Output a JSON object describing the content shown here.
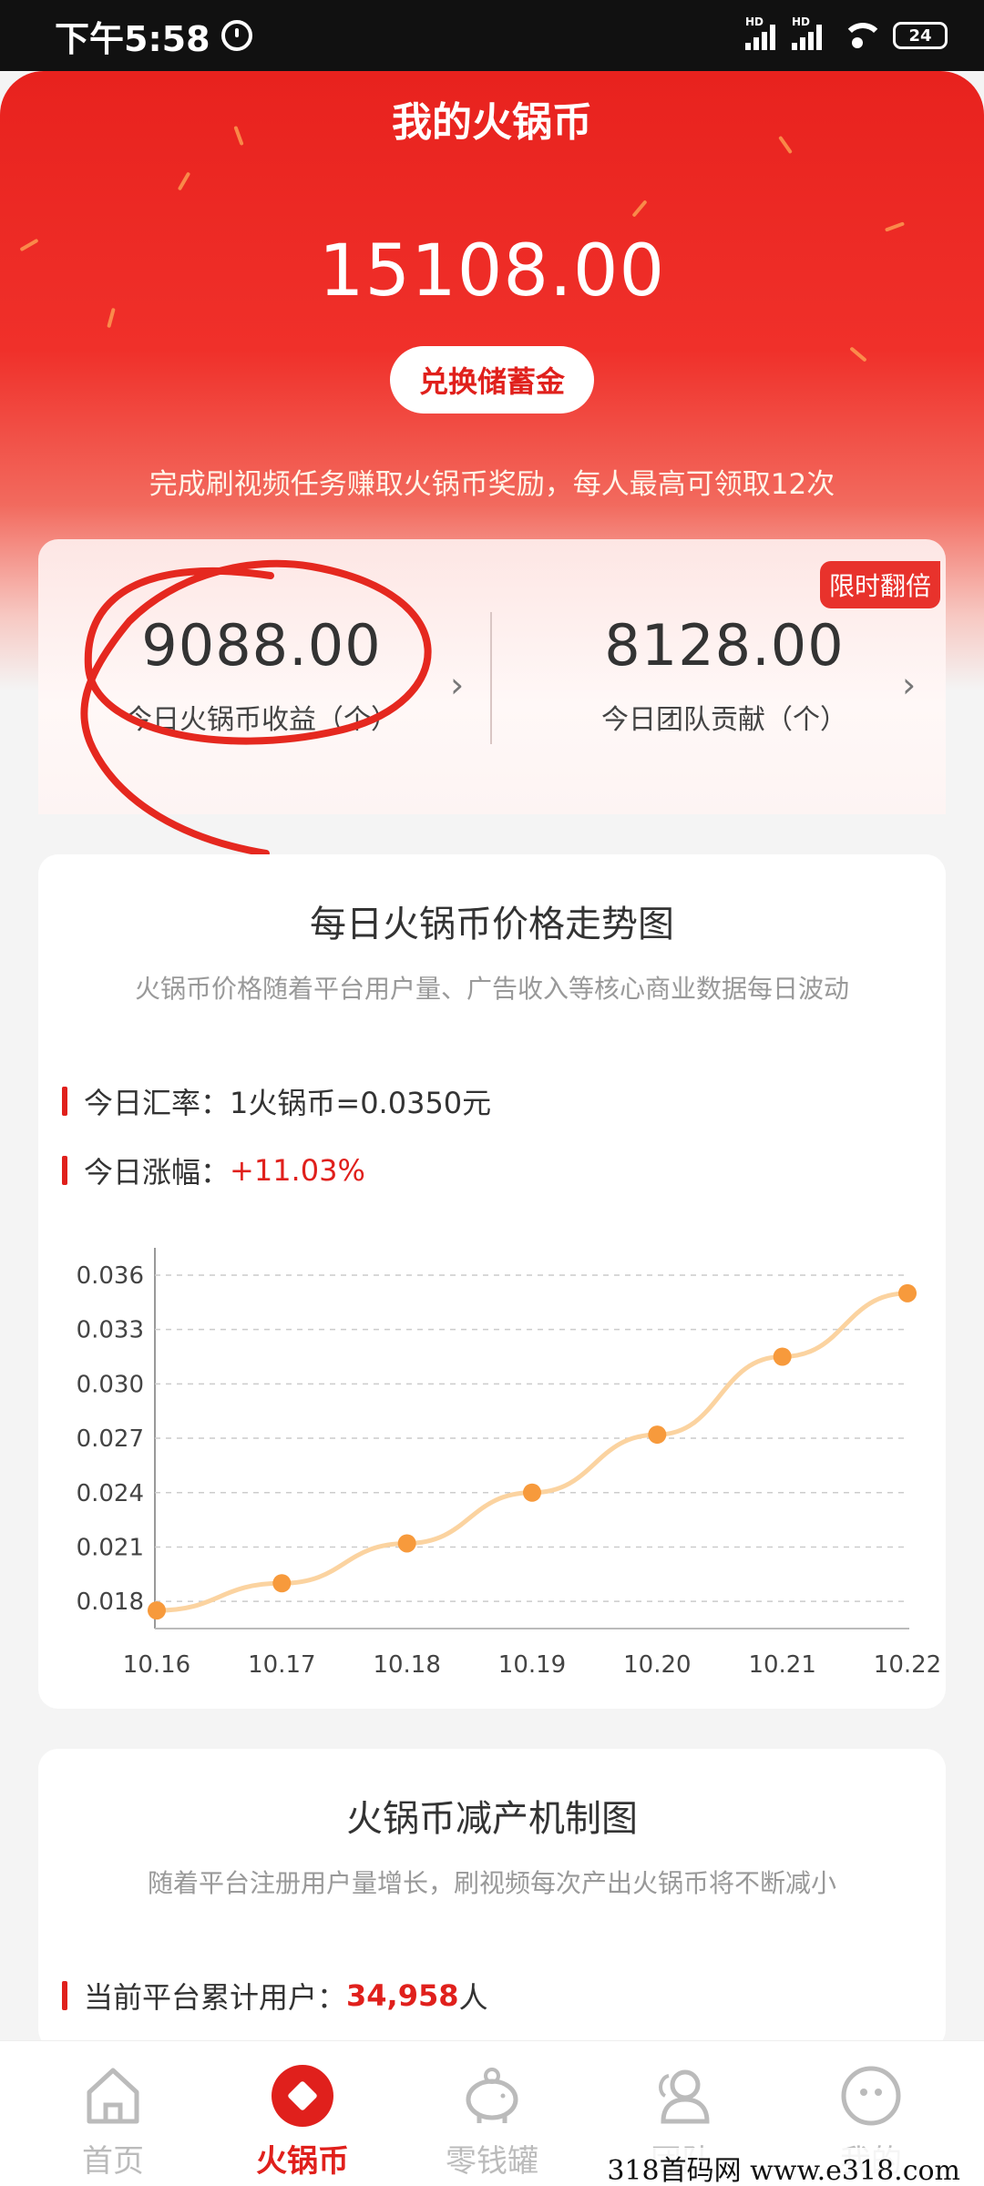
{
  "status_bar": {
    "time": "下午5:58",
    "hd1": "HD",
    "hd2": "HD",
    "battery": "24"
  },
  "header": {
    "title": "我的火锅币",
    "balance": "15108.00",
    "exchange_button": "兑换储蓄金",
    "task_desc": "完成刷视频任务赚取火锅币奖励，每人最高可领取12次"
  },
  "stats": {
    "badge": "限时翻倍",
    "today_earnings_value": "9088.00",
    "today_earnings_label": "今日火锅币收益（个）",
    "team_contribution_value": "8128.00",
    "team_contribution_label": "今日团队贡献（个）"
  },
  "price_card": {
    "title": "每日火锅币价格走势图",
    "subtitle": "火锅币价格随着平台用户量、广告收入等核心商业数据每日波动",
    "rate_label": "今日汇率：",
    "rate_value": "1火锅币=0.0350元",
    "change_label": "今日涨幅：",
    "change_value": "+11.03%"
  },
  "chart_data": {
    "type": "line",
    "title": "",
    "xlabel": "",
    "ylabel": "",
    "categories": [
      "10.16",
      "10.17",
      "10.18",
      "10.19",
      "10.20",
      "10.21",
      "10.22"
    ],
    "values": [
      0.0175,
      0.019,
      0.0212,
      0.024,
      0.0272,
      0.0315,
      0.035
    ],
    "ylim": [
      0.0165,
      0.0365
    ],
    "yticks": [
      "0.036",
      "0.033",
      "0.030",
      "0.027",
      "0.024",
      "0.021",
      "0.018"
    ],
    "ytick_values": [
      0.036,
      0.033,
      0.03,
      0.027,
      0.024,
      0.021,
      0.018
    ],
    "grid": true,
    "line_color": "#fbd3a0",
    "point_color": "#f79a3c"
  },
  "reduction_card": {
    "title": "火锅币减产机制图",
    "subtitle": "随着平台注册用户量增长，刷视频每次产出火锅币将不断减小",
    "users_label": "当前平台累计用户：",
    "users_value": "34,958",
    "users_unit": "人"
  },
  "nav": [
    {
      "label": "首页",
      "icon": "home-icon"
    },
    {
      "label": "火锅币",
      "icon": "coin-icon"
    },
    {
      "label": "零钱罐",
      "icon": "piggy-bank-icon"
    },
    {
      "label": "团队",
      "icon": "team-icon"
    },
    {
      "label": "我的",
      "icon": "profile-icon"
    }
  ],
  "watermark": "318首码网  www.e318.com",
  "colors": {
    "brand_red": "#e0201c",
    "inactive": "#bbbbbb"
  }
}
